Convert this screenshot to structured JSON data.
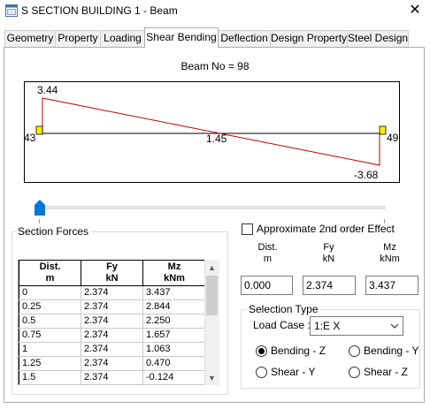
{
  "window": {
    "title": "S SECTION BUILDING 1 - Beam",
    "close_symbol": "✕"
  },
  "tabs": [
    {
      "label": "Geometry"
    },
    {
      "label": "Property"
    },
    {
      "label": "Loading"
    },
    {
      "label": "Shear Bending",
      "active": true
    },
    {
      "label": "Deflection"
    },
    {
      "label": "Design Property"
    },
    {
      "label": "Steel Design"
    }
  ],
  "beam_label": "Beam No = 98",
  "diagram": {
    "start_node": "43",
    "end_node": "49",
    "start_value": "3.44",
    "end_value": "-3.68",
    "mid_value": "1.45",
    "colors": {
      "curve": "#c00000",
      "support": "#ffee00",
      "axis": "#000000"
    }
  },
  "slider": {
    "position_fraction": 0.0,
    "thumb_color": "#0078d7"
  },
  "section_forces": {
    "label": "Section Forces",
    "columns": [
      {
        "line1": "Dist.",
        "line2": "m"
      },
      {
        "line1": "Fy",
        "line2": "kN"
      },
      {
        "line1": "Mz",
        "line2": "kNm"
      }
    ],
    "rows": [
      [
        "0",
        "2.374",
        "3.437"
      ],
      [
        "0.25",
        "2.374",
        "2.844"
      ],
      [
        "0.5",
        "2.374",
        "2.250"
      ],
      [
        "0.75",
        "2.374",
        "1.657"
      ],
      [
        "1",
        "2.374",
        "1.063"
      ],
      [
        "1.25",
        "2.374",
        "0.470"
      ],
      [
        "1.5",
        "2.374",
        "-0.124"
      ]
    ]
  },
  "approx_2nd_order": {
    "label": "Approximate 2nd order Effect",
    "checked": false
  },
  "current": {
    "columns": [
      {
        "line1": "Dist.",
        "line2": "m",
        "value": "0.000"
      },
      {
        "line1": "Fy",
        "line2": "kN",
        "value": "2.374"
      },
      {
        "line1": "Mz",
        "line2": "kNm",
        "value": "3.437"
      }
    ]
  },
  "selection": {
    "label": "Selection Type",
    "load_case_label": "Load Case :",
    "load_case_value": "1:E X",
    "options": [
      {
        "label": "Bending - Z",
        "selected": true
      },
      {
        "label": "Bending - Y",
        "selected": false
      },
      {
        "label": "Shear - Y",
        "selected": false
      },
      {
        "label": "Shear - Z",
        "selected": false
      }
    ]
  },
  "icons": {
    "app": "app-window-icon",
    "close": "close-icon",
    "dropdown": "chevron-down-icon",
    "scroll_up": "scroll-up-icon",
    "scroll_down": "scroll-down-icon"
  }
}
